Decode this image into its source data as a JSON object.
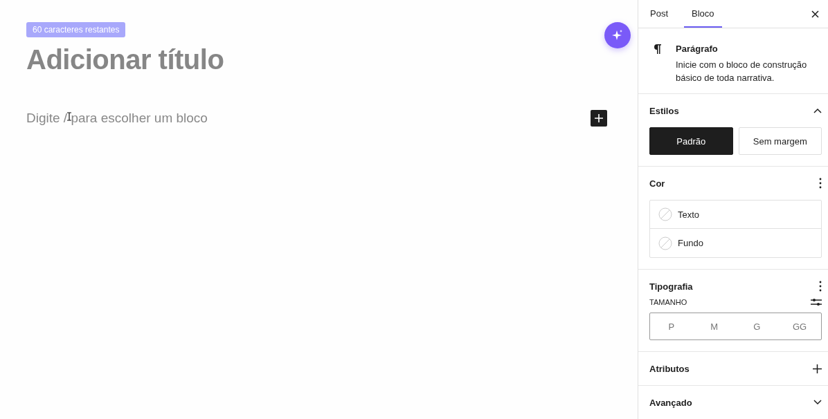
{
  "editor": {
    "char_badge": "60 caracteres restantes",
    "title_placeholder": "Adicionar título",
    "paragraph_placeholder": "Digite / para escolher um bloco"
  },
  "sidebar": {
    "tabs": [
      {
        "label": "Post",
        "selected": false
      },
      {
        "label": "Bloco",
        "selected": true
      }
    ],
    "block": {
      "name": "Parágrafo",
      "description": "Inicie com o bloco de construção básico de toda narrativa."
    },
    "panels": [
      {
        "kind": "chevron",
        "title": "Estilos",
        "expanded": true,
        "options": [
          {
            "label": "Padrão",
            "selected": true
          },
          {
            "label": "Sem margem",
            "selected": false
          }
        ]
      },
      {
        "kind": "menu",
        "title": "Cor",
        "items": [
          "Texto",
          "Fundo"
        ]
      },
      {
        "kind": "menu",
        "title": "Tipografia",
        "size_label": "TAMANHO",
        "sizes": [
          "P",
          "M",
          "G",
          "GG"
        ]
      },
      {
        "kind": "plus",
        "title": "Atributos"
      },
      {
        "kind": "chevron",
        "title": "Avançado",
        "expanded": false
      }
    ]
  }
}
